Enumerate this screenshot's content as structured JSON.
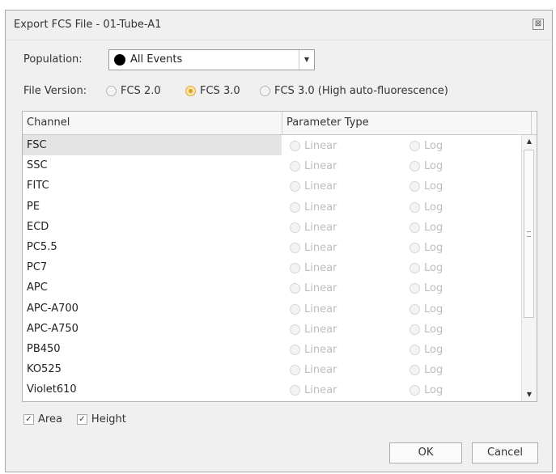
{
  "window": {
    "title": "Export FCS File - 01-Tube-A1",
    "close_glyph": "⊠"
  },
  "population": {
    "label": "Population:",
    "value": "All Events",
    "dot_color": "#000000"
  },
  "file_version": {
    "label": "File Version:",
    "options": [
      {
        "label": "FCS 2.0",
        "checked": false
      },
      {
        "label": "FCS 3.0",
        "checked": true
      },
      {
        "label": "FCS 3.0 (High auto-fluorescence)",
        "checked": false
      }
    ]
  },
  "grid": {
    "headers": [
      "Channel",
      "Parameter Type"
    ],
    "option_labels": [
      "Linear",
      "Log"
    ],
    "rows": [
      {
        "channel": "FSC",
        "selected": true
      },
      {
        "channel": "SSC"
      },
      {
        "channel": "FITC"
      },
      {
        "channel": "PE"
      },
      {
        "channel": "ECD"
      },
      {
        "channel": "PC5.5"
      },
      {
        "channel": "PC7"
      },
      {
        "channel": "APC"
      },
      {
        "channel": "APC-A700"
      },
      {
        "channel": "APC-A750"
      },
      {
        "channel": "PB450"
      },
      {
        "channel": "KO525"
      },
      {
        "channel": "Violet610"
      }
    ]
  },
  "checkboxes": [
    {
      "label": "Area",
      "checked": true
    },
    {
      "label": "Height",
      "checked": true
    }
  ],
  "buttons": {
    "ok": "OK",
    "cancel": "Cancel"
  }
}
